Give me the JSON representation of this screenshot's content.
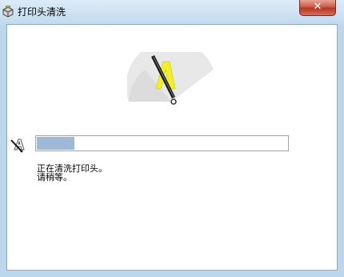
{
  "window": {
    "title": "打印头清洗",
    "close_label": "✕"
  },
  "progress": {
    "fraction": 0.15
  },
  "message": {
    "line1": "正在清洗打印头。",
    "line2": "请稍等。"
  },
  "icons": {
    "app": "printer-cleaning-app-icon",
    "graphic": "print-head-cleaning-wiper-icon",
    "status": "print-head-icon"
  },
  "colors": {
    "progress_fill": "#9fb8d6",
    "graphic_yellow": "#f2ef2a"
  }
}
